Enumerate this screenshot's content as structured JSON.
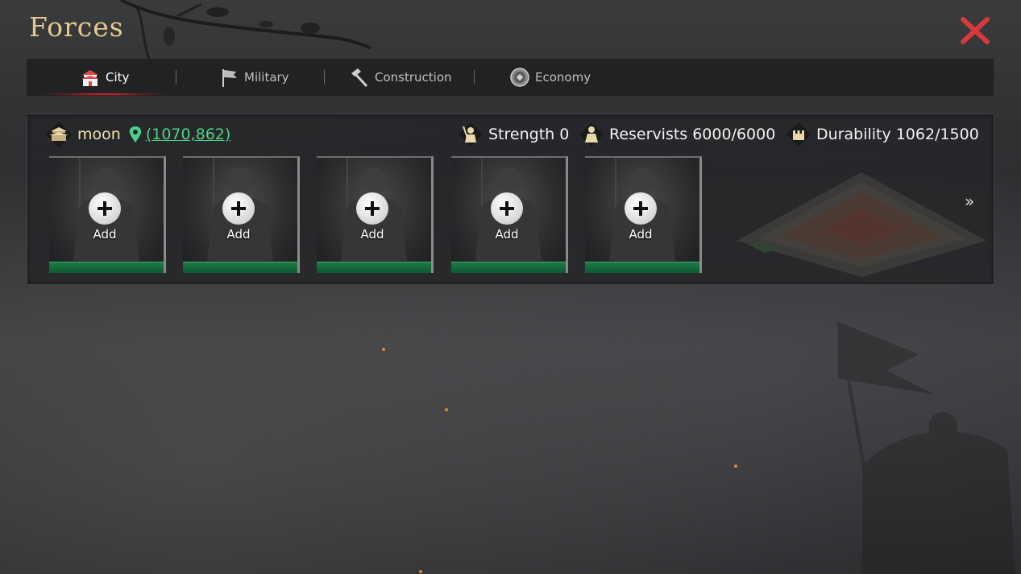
{
  "window": {
    "title": "Forces"
  },
  "tabs": [
    {
      "label": "City",
      "icon": "city-gate-icon",
      "active": true
    },
    {
      "label": "Military",
      "icon": "flag-icon",
      "active": false
    },
    {
      "label": "Construction",
      "icon": "hammer-icon",
      "active": false
    },
    {
      "label": "Economy",
      "icon": "coin-icon",
      "active": false
    }
  ],
  "city": {
    "name": "moon",
    "coordinates": "(1070,862)"
  },
  "stats": {
    "strength_label": "Strength",
    "strength_value": "0",
    "reservists_label": "Reservists",
    "reservists_value": "6000/6000",
    "durability_label": "Durability",
    "durability_value": "1062/1500"
  },
  "slots": [
    {
      "label": "Add"
    },
    {
      "label": "Add"
    },
    {
      "label": "Add"
    },
    {
      "label": "Add"
    },
    {
      "label": "Add"
    }
  ],
  "more_label": "»",
  "colors": {
    "title": "#e6c98e",
    "accent_red": "#d83a3a",
    "coords_green": "#4fd08a",
    "slot_base_green": "#0c5a30"
  }
}
